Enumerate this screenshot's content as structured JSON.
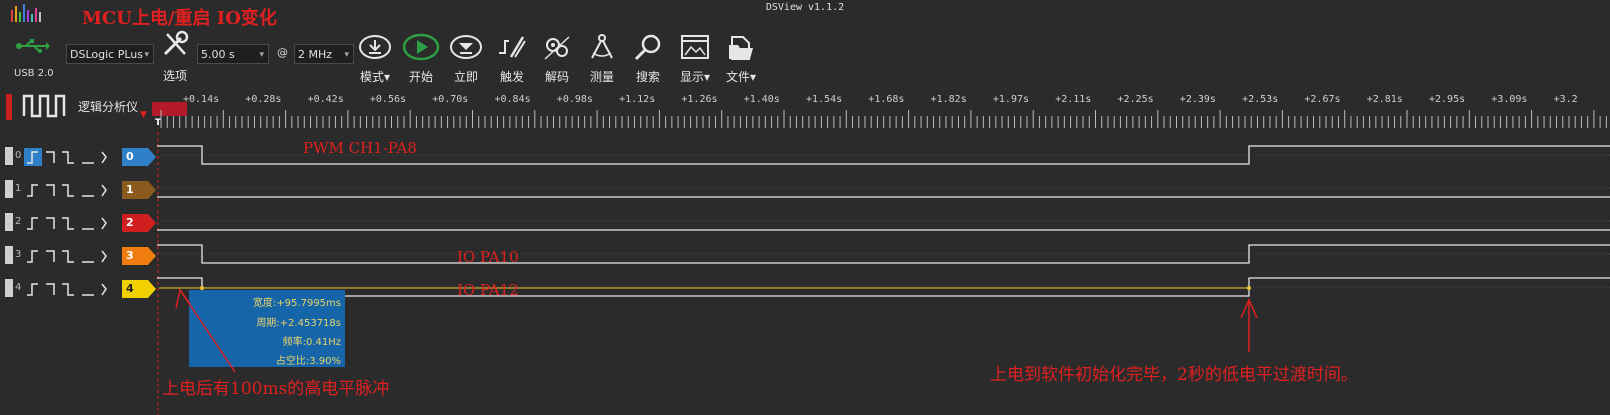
{
  "app": {
    "title": "DSView v1.1.2"
  },
  "annotation_title": "MCU上电/重启 IO变化",
  "usb": {
    "label": "USB 2.0",
    "icon": "usb-icon"
  },
  "toolbar": {
    "device": "DSLogic PLus",
    "options_label": "选项",
    "duration": "5.00 s",
    "at": "@",
    "rate": "2 MHz",
    "buttons": [
      {
        "id": "mode",
        "label": "模式",
        "icon": "download-circle-icon",
        "dropdown": true
      },
      {
        "id": "start",
        "label": "开始",
        "icon": "play-circle-icon",
        "dropdown": false
      },
      {
        "id": "instant",
        "label": "立即",
        "icon": "instant-circle-icon",
        "dropdown": false
      },
      {
        "id": "trigger",
        "label": "触发",
        "icon": "trigger-icon",
        "dropdown": false
      },
      {
        "id": "decode",
        "label": "解码",
        "icon": "decode-icon",
        "dropdown": false
      },
      {
        "id": "measure",
        "label": "测量",
        "icon": "compass-icon",
        "dropdown": false
      },
      {
        "id": "search",
        "label": "搜索",
        "icon": "magnifier-icon",
        "dropdown": false
      },
      {
        "id": "display",
        "label": "显示",
        "icon": "display-icon",
        "dropdown": true
      },
      {
        "id": "file",
        "label": "文件",
        "icon": "file-icon",
        "dropdown": true
      }
    ]
  },
  "analyzer": {
    "label": "逻辑分析仪"
  },
  "ruler": {
    "ticks": [
      "+0.14s",
      "+0.28s",
      "+0.42s",
      "+0.56s",
      "+0.70s",
      "+0.84s",
      "+0.98s",
      "+1.12s",
      "+1.26s",
      "+1.40s",
      "+1.54s",
      "+1.68s",
      "+1.82s",
      "+1.97s",
      "+2.11s",
      "+2.25s",
      "+2.39s",
      "+2.53s",
      "+2.67s",
      "+2.81s",
      "+2.95s",
      "+3.09s",
      "+3.2"
    ],
    "cursor_marker": "T"
  },
  "channels": [
    {
      "index": "0",
      "tag": "0",
      "color": "#2f7fc9",
      "signal": "PWM CH1-PA8"
    },
    {
      "index": "1",
      "tag": "1",
      "color": "#8a5a1e",
      "signal": ""
    },
    {
      "index": "2",
      "tag": "2",
      "color": "#d11f1f",
      "signal": ""
    },
    {
      "index": "3",
      "tag": "3",
      "color": "#f07b0f",
      "signal": "IO PA10"
    },
    {
      "index": "4",
      "tag": "4",
      "color": "#f0d000",
      "signal": "IO PA12"
    }
  ],
  "measurement": {
    "width": "宽度:+95.7995ms",
    "period": "周期:+2.453718s",
    "freq": "频率:0.41Hz",
    "duty": "占空比:3.90%"
  },
  "annotations": {
    "pulse": "上电后有100ms的高电平脉冲",
    "transition": "上电到软件初始化完毕，2秒的低电平过渡时间。"
  },
  "colors": {
    "accent_red": "#e02020",
    "start_green": "#2ea043",
    "measure_blue": "#1565a8"
  }
}
